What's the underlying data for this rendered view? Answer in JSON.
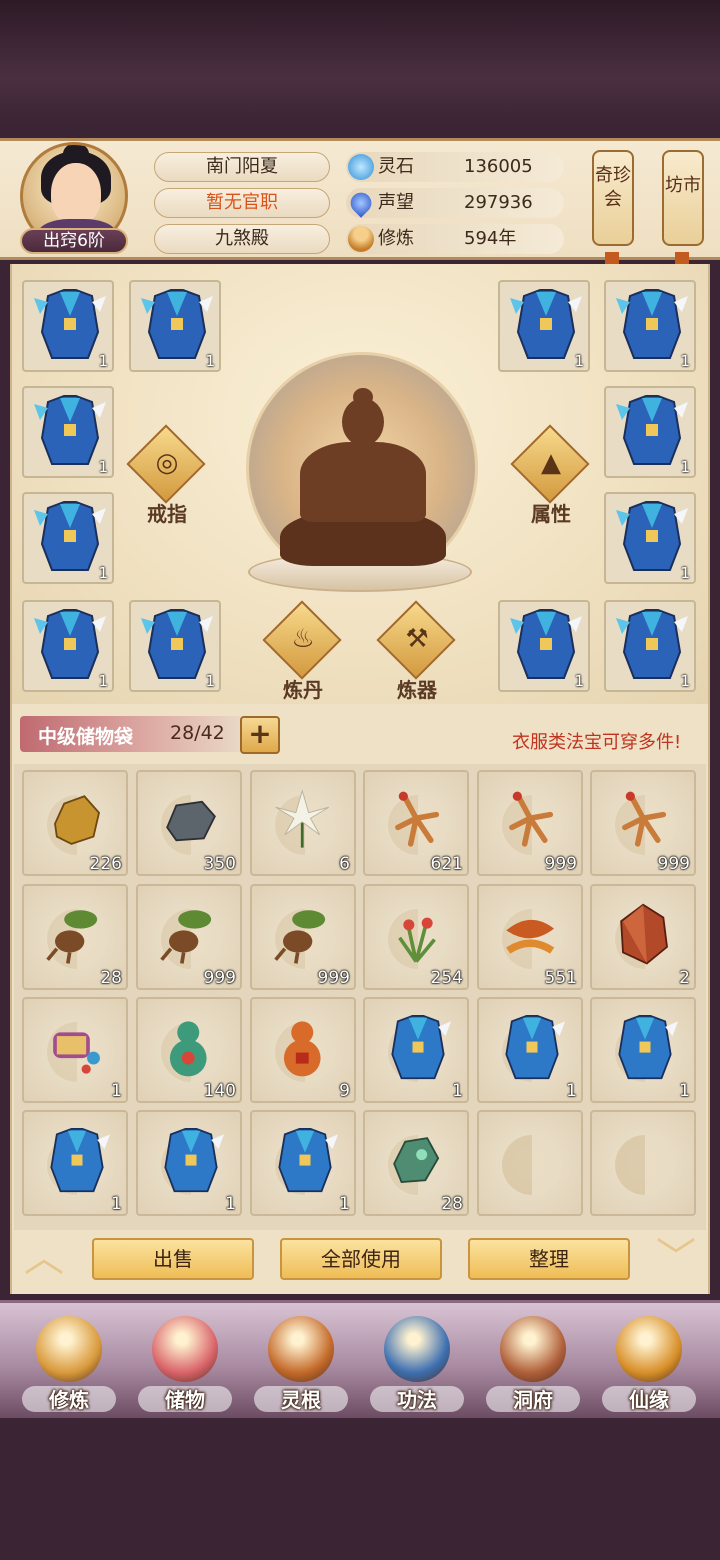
{
  "header": {
    "rank_label": "出窍6阶",
    "name": "南门阳夏",
    "title": "暂无官职",
    "sect": "九煞殿",
    "stats": [
      {
        "name": "灵石",
        "value": "136005",
        "icon": "spirit-stone-icon",
        "color": "#49a6e6"
      },
      {
        "name": "声望",
        "value": "297936",
        "icon": "reputation-flame-icon",
        "color": "#3a6ee0"
      },
      {
        "name": "修炼",
        "value": "594年",
        "icon": "meditation-icon",
        "color": "#d99a3c"
      }
    ],
    "side_buttons": [
      "奇珍会",
      "坊市"
    ]
  },
  "equipment": {
    "slot_qty": "1",
    "actions": [
      {
        "label": "戒指",
        "icon": "ring-icon"
      },
      {
        "label": "属性",
        "icon": "attribute-hat-icon"
      },
      {
        "label": "炼丹",
        "icon": "cauldron-icon"
      },
      {
        "label": "炼器",
        "icon": "anvil-icon"
      }
    ]
  },
  "bag": {
    "title": "中级储物袋",
    "count": "28/42",
    "plus": "+",
    "hint": "衣服类法宝可穿多件!"
  },
  "inventory": [
    {
      "item": "gold-ore",
      "qty": "226",
      "color": "#c8942f"
    },
    {
      "item": "iron-ore",
      "qty": "350",
      "color": "#5c646c"
    },
    {
      "item": "white-lily",
      "qty": "6",
      "color": "#f4f1e6"
    },
    {
      "item": "ginseng",
      "qty": "621",
      "color": "#c97b3a"
    },
    {
      "item": "ginseng",
      "qty": "999",
      "color": "#c97b3a"
    },
    {
      "item": "ginseng",
      "qty": "999",
      "color": "#c97b3a"
    },
    {
      "item": "herb-root",
      "qty": "28",
      "color": "#6d8a3a"
    },
    {
      "item": "herb-root",
      "qty": "999",
      "color": "#6d8a3a"
    },
    {
      "item": "herb-root",
      "qty": "999",
      "color": "#6d8a3a"
    },
    {
      "item": "flower-herb",
      "qty": "254",
      "color": "#5f8f3a"
    },
    {
      "item": "red-root",
      "qty": "551",
      "color": "#c95a22"
    },
    {
      "item": "red-crystal",
      "qty": "2",
      "color": "#b24a2a"
    },
    {
      "item": "scroll-artifact",
      "qty": "1",
      "color": "#a24d8c"
    },
    {
      "item": "green-gourd",
      "qty": "140",
      "color": "#3d9a7a"
    },
    {
      "item": "orange-gourd",
      "qty": "9",
      "color": "#d86a2a"
    },
    {
      "item": "robe",
      "qty": "1",
      "color": "#2d79c7"
    },
    {
      "item": "robe",
      "qty": "1",
      "color": "#2d79c7"
    },
    {
      "item": "robe",
      "qty": "1",
      "color": "#2d79c7"
    },
    {
      "item": "robe",
      "qty": "1",
      "color": "#2d79c7"
    },
    {
      "item": "robe",
      "qty": "1",
      "color": "#2d79c7"
    },
    {
      "item": "robe",
      "qty": "1",
      "color": "#2d79c7"
    },
    {
      "item": "jade-stones",
      "qty": "28",
      "color": "#4f8d73"
    }
  ],
  "actions": {
    "sell": "出售",
    "use_all": "全部使用",
    "sort": "整理"
  },
  "nav": [
    {
      "label": "修炼",
      "icon": "cultivation-monk-icon",
      "color": "#d99a3c"
    },
    {
      "label": "储物",
      "icon": "storage-bag-icon",
      "color": "#d9646a"
    },
    {
      "label": "灵根",
      "icon": "spirit-root-icon",
      "color": "#c46a2a"
    },
    {
      "label": "功法",
      "icon": "technique-book-icon",
      "color": "#3d6fb0"
    },
    {
      "label": "洞府",
      "icon": "cave-mansion-icon",
      "color": "#b0603a"
    },
    {
      "label": "仙缘",
      "icon": "fortune-gourd-icon",
      "color": "#d8902a"
    }
  ]
}
